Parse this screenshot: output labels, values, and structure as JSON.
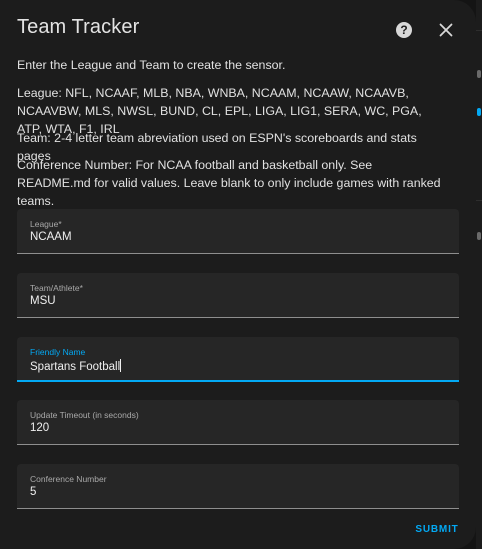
{
  "dialog": {
    "title": "Team Tracker",
    "help_icon": "help-circle-icon",
    "help_glyph": "?",
    "close_icon": "close-icon"
  },
  "descriptions": {
    "intro": "Enter the League and Team to create the sensor.",
    "leagues": "League: NFL, NCAAF, MLB, NBA, WNBA, NCAAM, NCAAW, NCAAVB, NCAAVBW, MLS, NWSL, BUND, CL, EPL, LIGA, LIG1, SERA, WC, PGA, ATP, WTA, F1, IRL",
    "team": "Team: 2-4 letter team abreviation used on ESPN's scoreboards and stats pages",
    "conference": "Conference Number: For NCAA football and basketball only. See README.md for valid values. Leave blank to only include games with ranked teams."
  },
  "fields": {
    "league": {
      "label": "League*",
      "value": "NCAAM"
    },
    "team": {
      "label": "Team/Athlete*",
      "value": "MSU"
    },
    "friendly_name": {
      "label": "Friendly Name",
      "value": "Spartans Football"
    },
    "timeout": {
      "label": "Update Timeout (in seconds)",
      "value": "120"
    },
    "conference": {
      "label": "Conference Number",
      "value": "5"
    }
  },
  "actions": {
    "submit_label": "SUBMIT"
  },
  "colors": {
    "accent": "#03a9f4",
    "surface": "#1c1c1c",
    "field_bg": "#262626"
  }
}
